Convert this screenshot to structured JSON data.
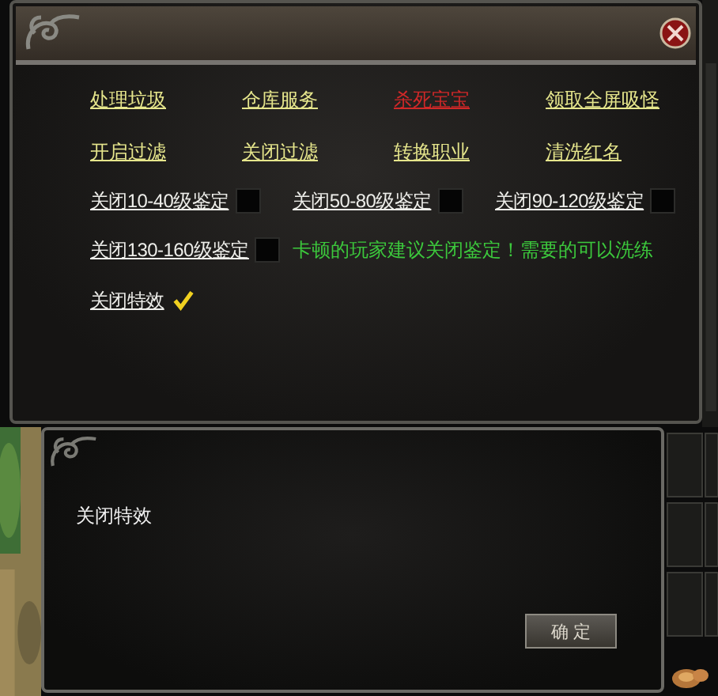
{
  "dialog": {
    "links": [
      {
        "label": "处理垃圾",
        "kind": "normal"
      },
      {
        "label": "仓库服务",
        "kind": "normal"
      },
      {
        "label": "杀死宝宝",
        "kind": "danger"
      },
      {
        "label": "领取全屏吸怪",
        "kind": "normal"
      },
      {
        "label": "开启过滤",
        "kind": "normal"
      },
      {
        "label": "关闭过滤",
        "kind": "normal"
      },
      {
        "label": "转换职业",
        "kind": "normal"
      },
      {
        "label": "清洗红名",
        "kind": "normal"
      }
    ],
    "toggles": [
      {
        "label": "关闭10-40级鉴定",
        "checked": false
      },
      {
        "label": "关闭50-80级鉴定",
        "checked": false
      },
      {
        "label": "关闭90-120级鉴定",
        "checked": false
      },
      {
        "label": "关闭130-160级鉴定",
        "checked": false
      }
    ],
    "notice": "卡顿的玩家建议关闭鉴定！需要的可以洗练",
    "effects_toggle": {
      "label": "关闭特效",
      "checked": true
    }
  },
  "message_box": {
    "text": "关闭特效",
    "button": "确 定"
  }
}
